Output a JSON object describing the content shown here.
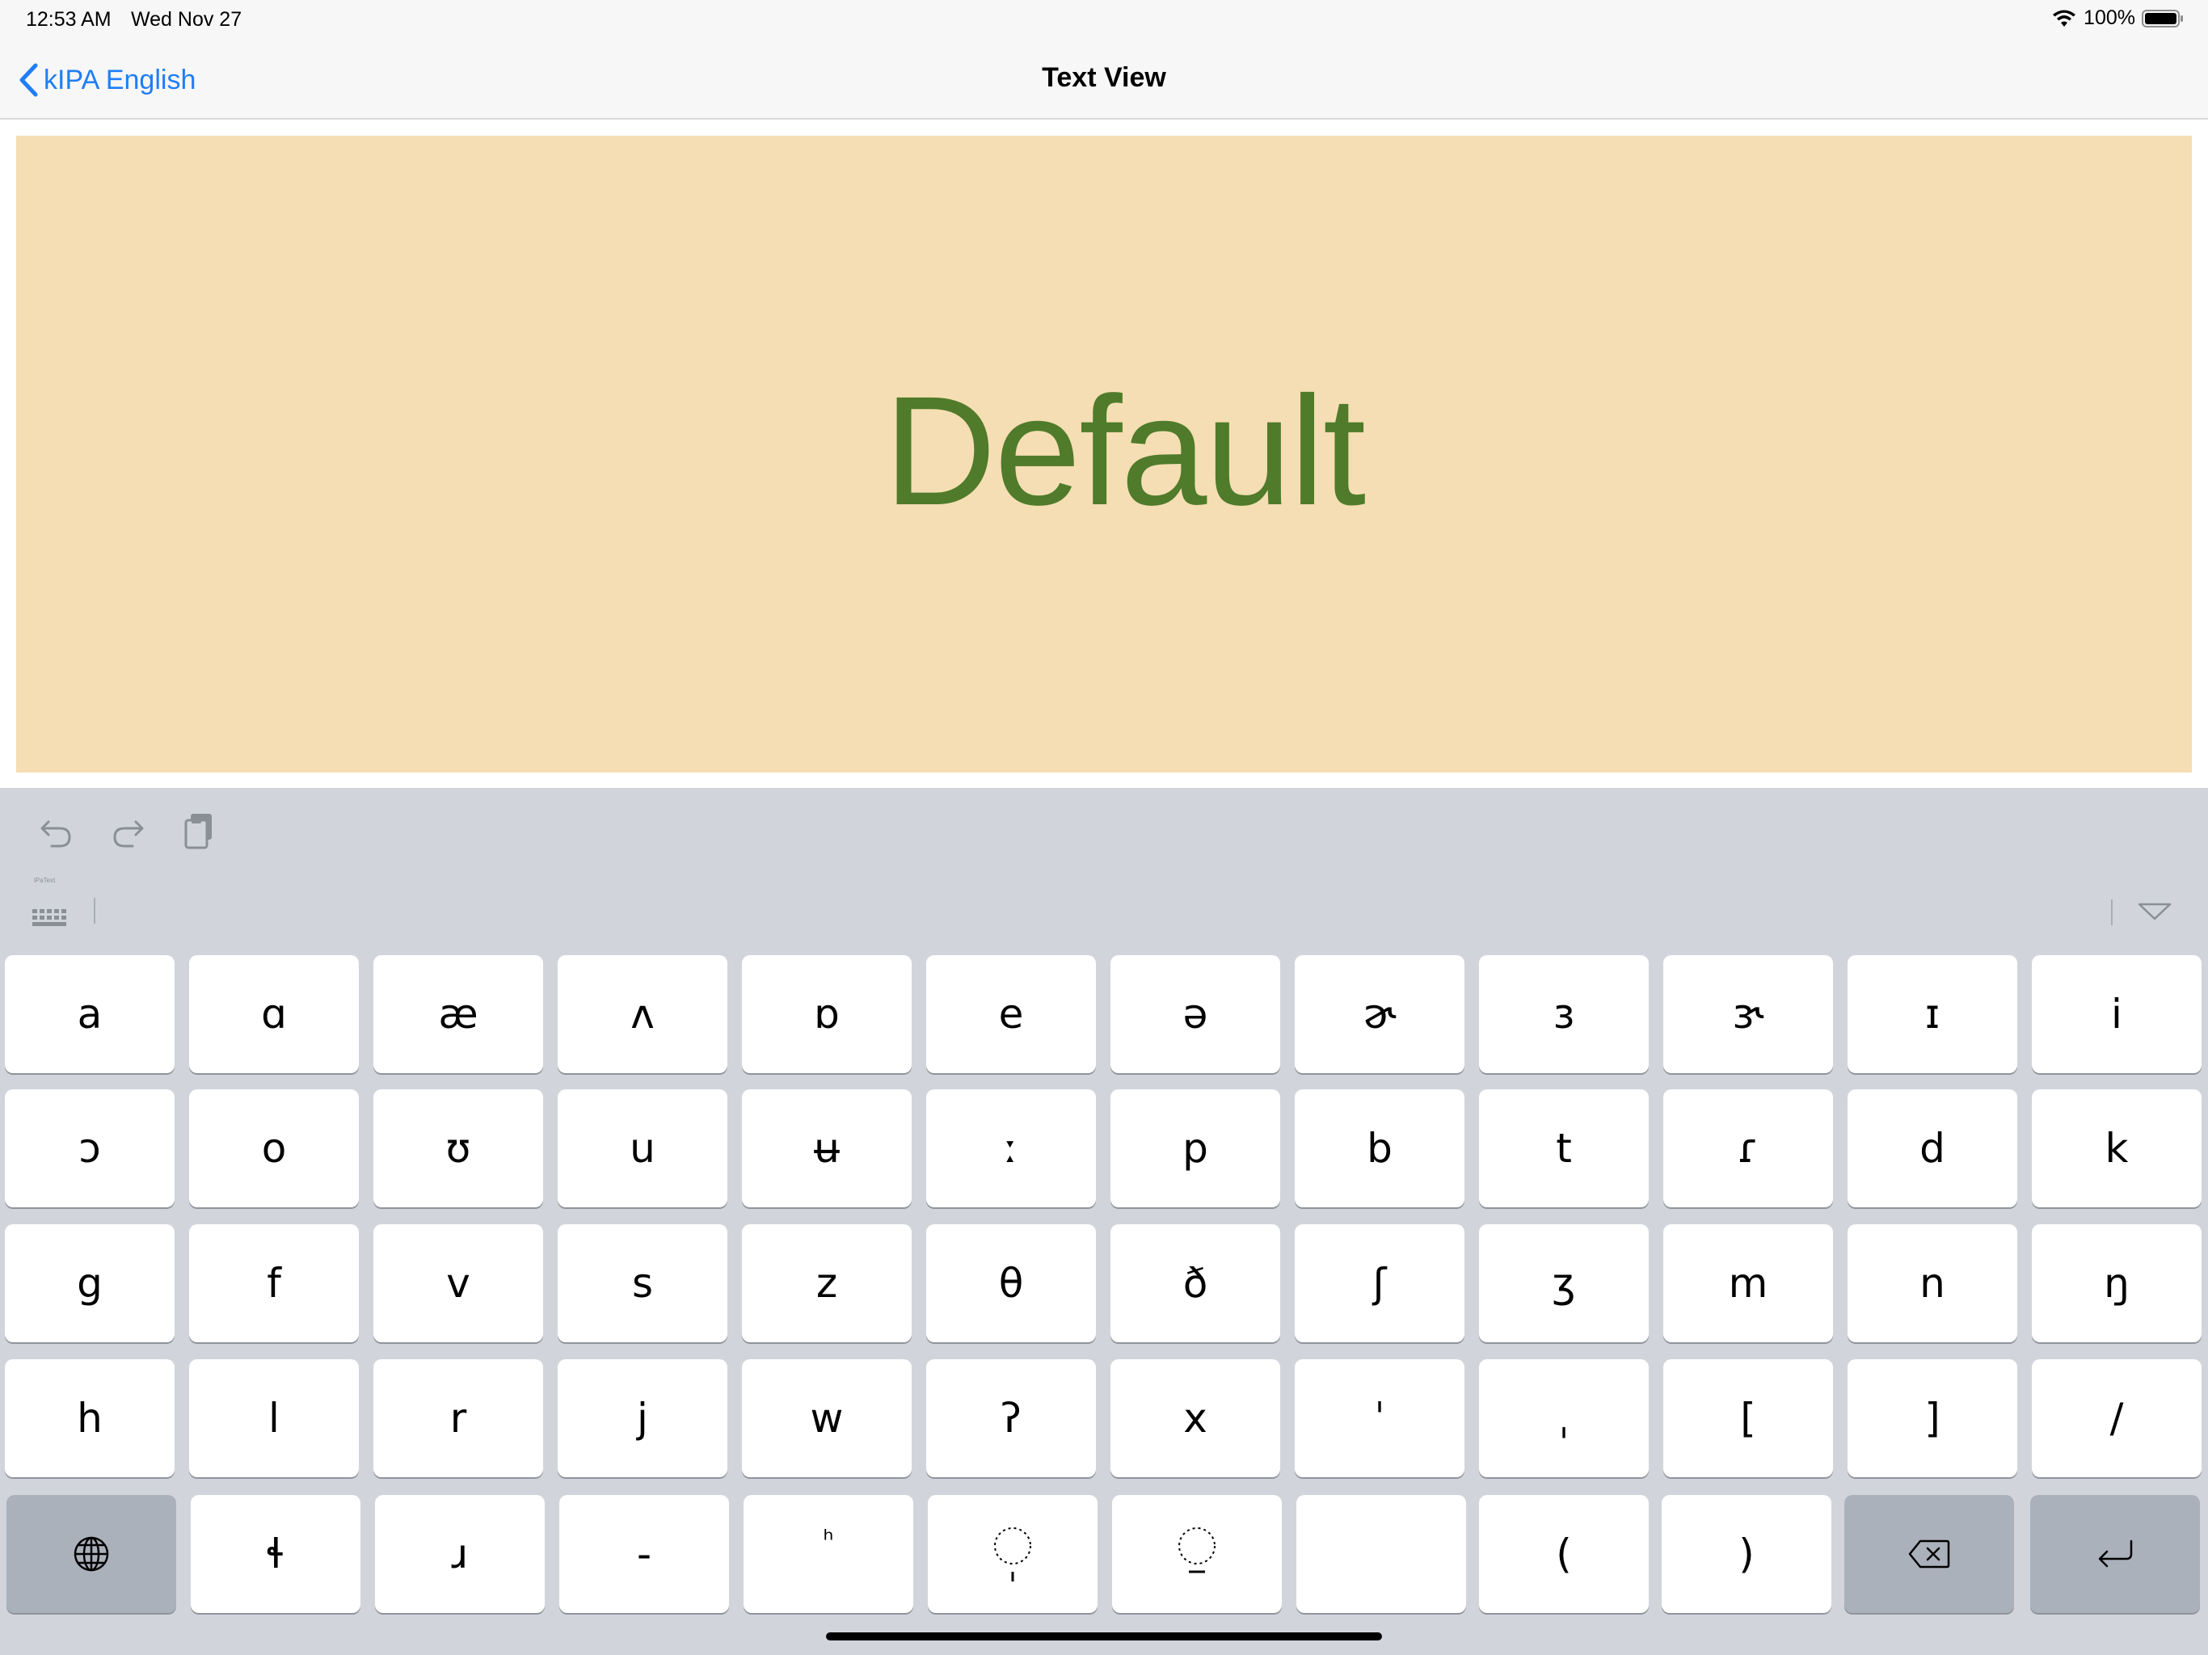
{
  "status_bar": {
    "time": "12:53 AM",
    "date": "Wed Nov 27",
    "battery": "100%"
  },
  "nav": {
    "back_label": "kIPA English",
    "title": "Text View"
  },
  "text_view": {
    "content": "Default",
    "background": "#f5deb3",
    "text_color": "#4f7b2a"
  },
  "toolbar": {
    "kb_switch_label": "iPaText"
  },
  "keyboard": {
    "rows": [
      [
        "a",
        "ɑ",
        "æ",
        "ʌ",
        "ɒ",
        "e",
        "ə",
        "ɚ",
        "ɜ",
        "ɝ",
        "ɪ",
        "i"
      ],
      [
        "ɔ",
        "o",
        "ʊ",
        "u",
        "ʉ",
        "ː",
        "p",
        "b",
        "t",
        "ɾ",
        "d",
        "k"
      ],
      [
        "g",
        "f",
        "v",
        "s",
        "z",
        "θ",
        "ð",
        "ʃ",
        "ʒ",
        "m",
        "n",
        "ŋ"
      ],
      [
        "h",
        "l",
        "r",
        "j",
        "w",
        "ʔ",
        "x",
        "ˈ",
        "ˌ",
        "[",
        "]",
        "/"
      ],
      [
        "ɬ",
        "ɹ",
        "-",
        "ʰ",
        "",
        "",
        "",
        "(",
        ")"
      ]
    ]
  },
  "colors": {
    "accent": "#1f7ef6",
    "keyboard_bg": "#d1d5db",
    "dark_key": "#abb1bb"
  },
  "icons": {
    "undo": "undo-icon",
    "redo": "redo-icon",
    "paste": "paste-icon",
    "globe": "globe-icon",
    "delete": "delete-icon",
    "return": "return-icon",
    "dismiss": "dismiss-keyboard-icon"
  }
}
